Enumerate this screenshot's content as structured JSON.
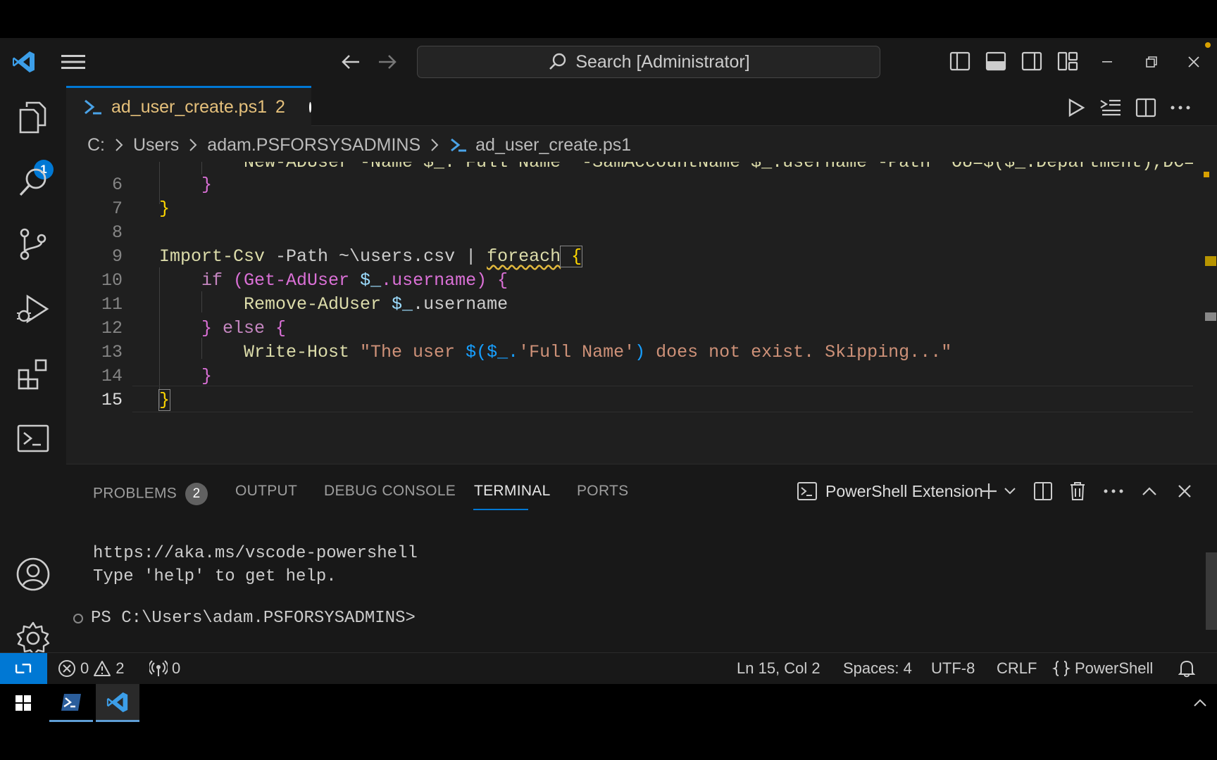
{
  "search": {
    "label": "Search [Administrator]"
  },
  "explorer_badge": "1",
  "tab": {
    "filename": "ad_user_create.ps1",
    "problems": "2"
  },
  "breadcrumb": [
    "C:",
    "Users",
    "adam.PSFORSYSADMINS",
    "ad_user_create.ps1"
  ],
  "code": {
    "line5": "New-ADUser -Name $_.'Full Name' -SamAccountName $_.username -Path \"OU=$($_.Department),DC=ps",
    "lines": [
      {
        "n": "6",
        "text": "}"
      },
      {
        "n": "7",
        "text": "}"
      },
      {
        "n": "8",
        "text": ""
      },
      {
        "n": "9",
        "cmd": "Import-Csv",
        "param": " -Path ~\\users.csv | ",
        "kw": "foreach",
        "brace": " {"
      },
      {
        "n": "10",
        "kw": "if",
        "rest": " (Get-AdUser ",
        "var": "$_",
        "tail": ".username) {"
      },
      {
        "n": "11",
        "cmd": "Remove-AdUser",
        "var": " $_",
        "tail": ".username"
      },
      {
        "n": "12",
        "close": "} ",
        "kw": "else",
        "brace": " {"
      },
      {
        "n": "13",
        "cmd": "Write-Host",
        "str1": " \"The user ",
        "sub": "$($_.",
        "str2": "'Full Name'",
        "sub2": ")",
        "str3": " does not exist. Skipping...\""
      },
      {
        "n": "14",
        "text": "}"
      },
      {
        "n": "15",
        "text": "}"
      }
    ]
  },
  "panel": {
    "tabs": [
      "PROBLEMS",
      "OUTPUT",
      "DEBUG CONSOLE",
      "TERMINAL",
      "PORTS"
    ],
    "problems_count": "2",
    "terminal_name": "PowerShell Extension",
    "terminal_lines": [
      "https://aka.ms/vscode-powershell",
      "Type 'help' to get help."
    ],
    "prompt": "PS C:\\Users\\adam.PSFORSYSADMINS>"
  },
  "status": {
    "errors": "0",
    "warnings": "2",
    "ports": "0",
    "position": "Ln 15, Col 2",
    "spaces": "Spaces: 4",
    "encoding": "UTF-8",
    "eol": "CRLF",
    "language": "PowerShell"
  },
  "colors": {
    "accent": "#0078d4",
    "editor_bg": "#1f1f1f",
    "chrome_bg": "#181818",
    "dirty_text": "#e5c07b"
  }
}
